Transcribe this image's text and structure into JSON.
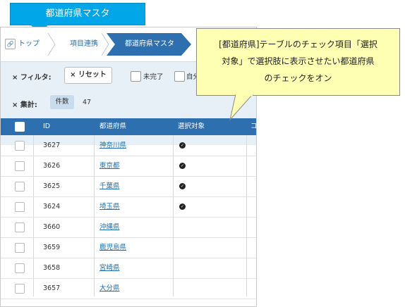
{
  "title_label": "都道府県マスタ",
  "breadcrumb": {
    "home_label": "トップ",
    "item1_label": "項目連携",
    "current_label": "都道府県マスタ"
  },
  "filter": {
    "filter_label": "フィルタ:",
    "reset_label": "リセット",
    "option_incomplete": "未完了",
    "option_self": "自分",
    "aggregate_label": "集計:",
    "count_label": "件数",
    "count_value": "47"
  },
  "table": {
    "headers": {
      "id": "ID",
      "prefecture": "都道府県",
      "selection_target": "選択対象",
      "extra": "コ"
    },
    "rows": [
      {
        "id": "3627",
        "prefecture": "神奈川県",
        "selected": true
      },
      {
        "id": "3626",
        "prefecture": "東京都",
        "selected": true
      },
      {
        "id": "3625",
        "prefecture": "千葉県",
        "selected": true
      },
      {
        "id": "3624",
        "prefecture": "埼玉県",
        "selected": true
      },
      {
        "id": "3660",
        "prefecture": "沖縄県",
        "selected": false
      },
      {
        "id": "3659",
        "prefecture": "鹿児島県",
        "selected": false
      },
      {
        "id": "3658",
        "prefecture": "宮崎県",
        "selected": false
      },
      {
        "id": "3657",
        "prefecture": "大分県",
        "selected": false
      }
    ]
  },
  "callout": {
    "line1": "[都道府県]テーブルのチェック項目「選択",
    "line2": "対象」で選択肢に表示させたい都道府県",
    "line3": "のチェックをオン"
  },
  "icons": {
    "home": "home-link-icon",
    "close": "close-x-icon",
    "check": "check-mark-icon"
  },
  "colors": {
    "accent_blue": "#2e6fb0",
    "title_cyan": "#00a6e8",
    "callout_yellow": "#ffffb4",
    "panel_bg": "#e7eff7"
  }
}
